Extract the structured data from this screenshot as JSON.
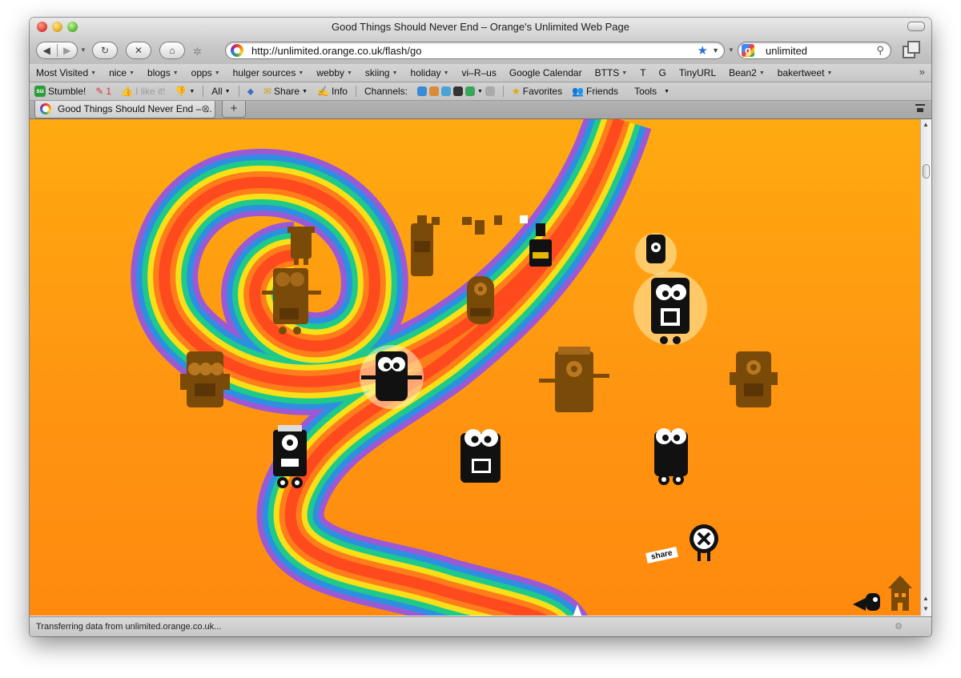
{
  "window": {
    "title": "Good Things Should Never End – Orange's Unlimited Web Page"
  },
  "navigation": {
    "back_icon": "back-arrow-icon",
    "forward_icon": "forward-arrow-icon",
    "url": "http://unlimited.orange.co.uk/flash/go",
    "search_query": "unlimited"
  },
  "bookmarks": [
    {
      "label": "Most Visited"
    },
    {
      "label": "nice"
    },
    {
      "label": "blogs"
    },
    {
      "label": "opps"
    },
    {
      "label": "hulger sources"
    },
    {
      "label": "webby"
    },
    {
      "label": "skiing"
    },
    {
      "label": "holiday"
    },
    {
      "label": "vi–R–us"
    },
    {
      "label": "Google Calendar"
    },
    {
      "label": "BTTS"
    },
    {
      "label": "T"
    },
    {
      "label": "G"
    },
    {
      "label": "TinyURL"
    },
    {
      "label": "Bean2"
    },
    {
      "label": "bakertweet"
    }
  ],
  "stumble_toolbar": {
    "stumble_label": "Stumble!",
    "thumbs_count": "1",
    "like_label": "I like it!",
    "all_label": "All",
    "share_label": "Share",
    "info_label": "Info",
    "channels_label": "Channels:",
    "favorites_label": "Favorites",
    "friends_label": "Friends",
    "tools_label": "Tools"
  },
  "tab": {
    "label": "Good Things Should Never End – ..."
  },
  "page": {
    "share_label": "share",
    "rainbow_colors": [
      "#9b59d6",
      "#2e8fe0",
      "#1ec98a",
      "#f7e017",
      "#ff7d1a",
      "#ff4a1e"
    ]
  },
  "status": {
    "text": "Transferring data from unlimited.orange.co.uk..."
  }
}
